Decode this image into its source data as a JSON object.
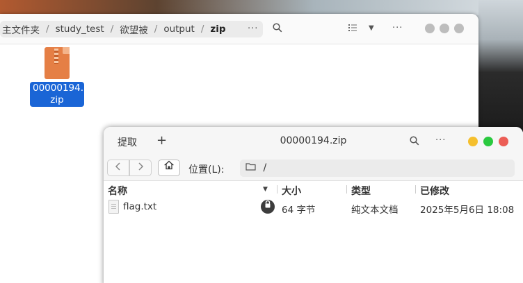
{
  "file_manager": {
    "path": [
      {
        "label": "主文件夹"
      },
      {
        "label": "study_test"
      },
      {
        "label": "欲望被"
      },
      {
        "label": "output"
      }
    ],
    "current_folder": "zip",
    "path_more": "···",
    "menu_glyph": "···",
    "file": {
      "name_line1": "00000194.",
      "name_line2": "zip"
    }
  },
  "archive_manager": {
    "extract_label": "提取",
    "add_glyph": "+",
    "title": "00000194.zip",
    "menu_glyph": "···",
    "location_label": "位置(L):",
    "location_path": "/",
    "columns": {
      "name": "名称",
      "size": "大小",
      "type": "类型",
      "modified": "已修改"
    },
    "rows": [
      {
        "name": "flag.txt",
        "size": "64 字节",
        "type": "纯文本文档",
        "modified": "2025年5月6日 18:08",
        "encrypted": true
      }
    ]
  },
  "colors": {
    "selection": "#1a65d6",
    "close": "#ec5e56",
    "minimize": "#f5bf2d",
    "maximize": "#2ac93f",
    "zip_icon": "#e57f45"
  }
}
